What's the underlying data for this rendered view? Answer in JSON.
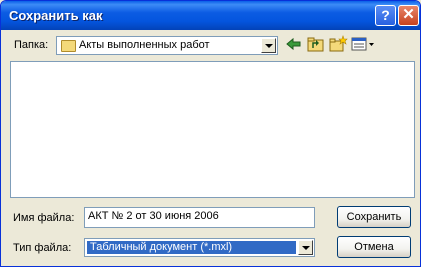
{
  "window": {
    "title": "Сохранить как",
    "help_label": "?",
    "close_label": "✕"
  },
  "folder": {
    "label": "Папка:",
    "value": "Акты выполненных работ"
  },
  "toolbar": {
    "back_icon": "back-arrow-icon",
    "up_icon": "up-folder-icon",
    "new_folder_icon": "new-folder-icon",
    "view_icon": "view-menu-icon"
  },
  "file_list": {
    "items": []
  },
  "filename": {
    "label": "Имя файла:",
    "value": "АКТ № 2 от 30 июня 2006"
  },
  "filetype": {
    "label": "Тип файла:",
    "value": "Табличный документ (*.mxl)"
  },
  "buttons": {
    "save": "Сохранить",
    "cancel": "Отмена"
  }
}
